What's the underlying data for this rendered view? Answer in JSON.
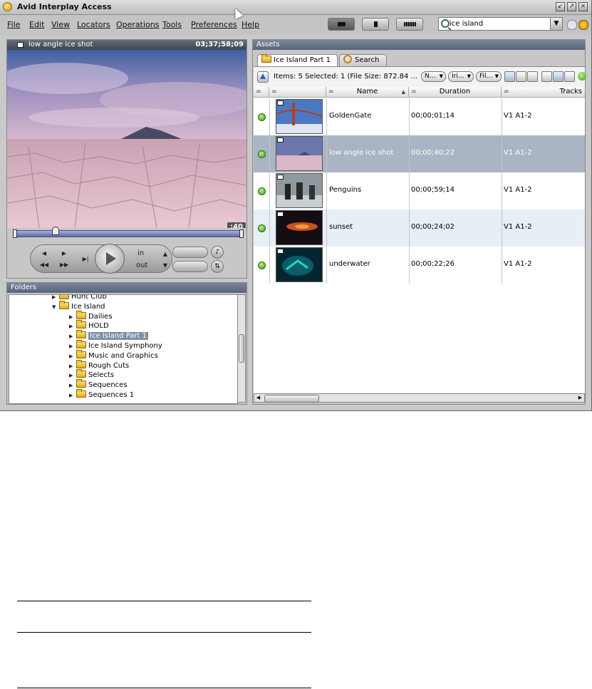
{
  "window": {
    "title": "Avid Interplay Access",
    "controls": [
      "minimize",
      "maximize",
      "close"
    ]
  },
  "menu": [
    "File",
    "Edit",
    "View",
    "Locators",
    "Operations",
    "Tools",
    "Preferences",
    "Help"
  ],
  "toolbar": {
    "search_value": "ice island"
  },
  "monitor": {
    "clip_name": "low angle ice shot",
    "timecode": "03;37;58;09",
    "time_badge": ":40",
    "in_label": "in",
    "out_label": "out"
  },
  "folders": {
    "title": "Folders",
    "items": [
      {
        "label": "Hunt Club",
        "depth": 0,
        "expanded": false,
        "selected": false
      },
      {
        "label": "Ice Island",
        "depth": 0,
        "expanded": true,
        "selected": false
      },
      {
        "label": "Dailies",
        "depth": 1,
        "expanded": false,
        "selected": false
      },
      {
        "label": "HOLD",
        "depth": 1,
        "expanded": false,
        "selected": false
      },
      {
        "label": "Ice Island Part 1",
        "depth": 1,
        "expanded": false,
        "selected": true
      },
      {
        "label": "Ice Island Symphony",
        "depth": 1,
        "expanded": false,
        "selected": false
      },
      {
        "label": "Music and Graphics",
        "depth": 1,
        "expanded": false,
        "selected": false
      },
      {
        "label": "Rough Cuts",
        "depth": 1,
        "expanded": false,
        "selected": false
      },
      {
        "label": "Selects",
        "depth": 1,
        "expanded": false,
        "selected": false
      },
      {
        "label": "Sequences",
        "depth": 1,
        "expanded": false,
        "selected": false
      },
      {
        "label": "Sequences 1",
        "depth": 1,
        "expanded": false,
        "selected": false
      }
    ]
  },
  "assets": {
    "title": "Assets",
    "tabs": [
      {
        "label": "Ice Island Part 1",
        "active": true
      },
      {
        "label": "Search",
        "active": false
      }
    ],
    "status": "Items: 5 Selected: 1 (File Size: 872.84 ...",
    "filters": [
      "N...",
      "Iri...",
      "Fil..."
    ],
    "columns": {
      "eq": "=",
      "name": "Name",
      "duration": "Duration",
      "tracks": "Tracks"
    },
    "rows": [
      {
        "name": "GoldenGate",
        "duration": "00;00;01;14",
        "tracks": "V1 A1-2",
        "selected": false,
        "alt": false,
        "thumb": "goldengate"
      },
      {
        "name": "low angle ice shot",
        "duration": "00;00;40;22",
        "tracks": "V1 A1-2",
        "selected": true,
        "alt": false,
        "thumb": "ice"
      },
      {
        "name": "Penguins",
        "duration": "00;00;59;14",
        "tracks": "V1 A1-2",
        "selected": false,
        "alt": false,
        "thumb": "penguins"
      },
      {
        "name": "sunset",
        "duration": "00;00;24;02",
        "tracks": "V1 A1-2",
        "selected": false,
        "alt": true,
        "thumb": "sunset"
      },
      {
        "name": "underwater",
        "duration": "00;00;22;26",
        "tracks": "V1 A1-2",
        "selected": false,
        "alt": false,
        "thumb": "underwater"
      }
    ]
  },
  "colors": {
    "panel_header": "#6b778c",
    "selected_row": "#a9b4c4",
    "status_green": "#3c9a19"
  }
}
